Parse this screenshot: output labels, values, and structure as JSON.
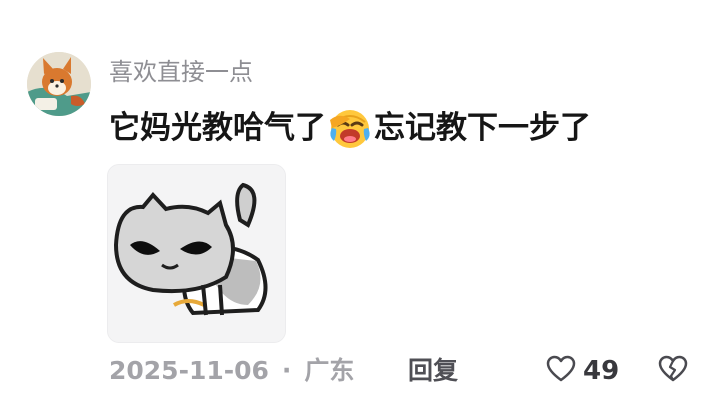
{
  "comment": {
    "username": "喜欢直接一点",
    "text_before_emoji": "它妈光教哈气了",
    "emoji": "laughing-crying-face-emoji",
    "text_after_emoji": "忘记教下一步了",
    "sticker": "hissing-cat-sticker",
    "date": "2025-11-06",
    "separator": "·",
    "location": "广东",
    "reply_label": "回复",
    "like_count": "49",
    "avatar": "cartoon-fox-avatar",
    "like_icon": "heart-outline-icon",
    "dislike_icon": "broken-heart-icon"
  },
  "colors": {
    "username": "#8e8e93",
    "text": "#161616",
    "meta": "#a3a3a8",
    "reply": "#4f4f55",
    "like_count": "#38383d",
    "background": "#ffffff"
  }
}
